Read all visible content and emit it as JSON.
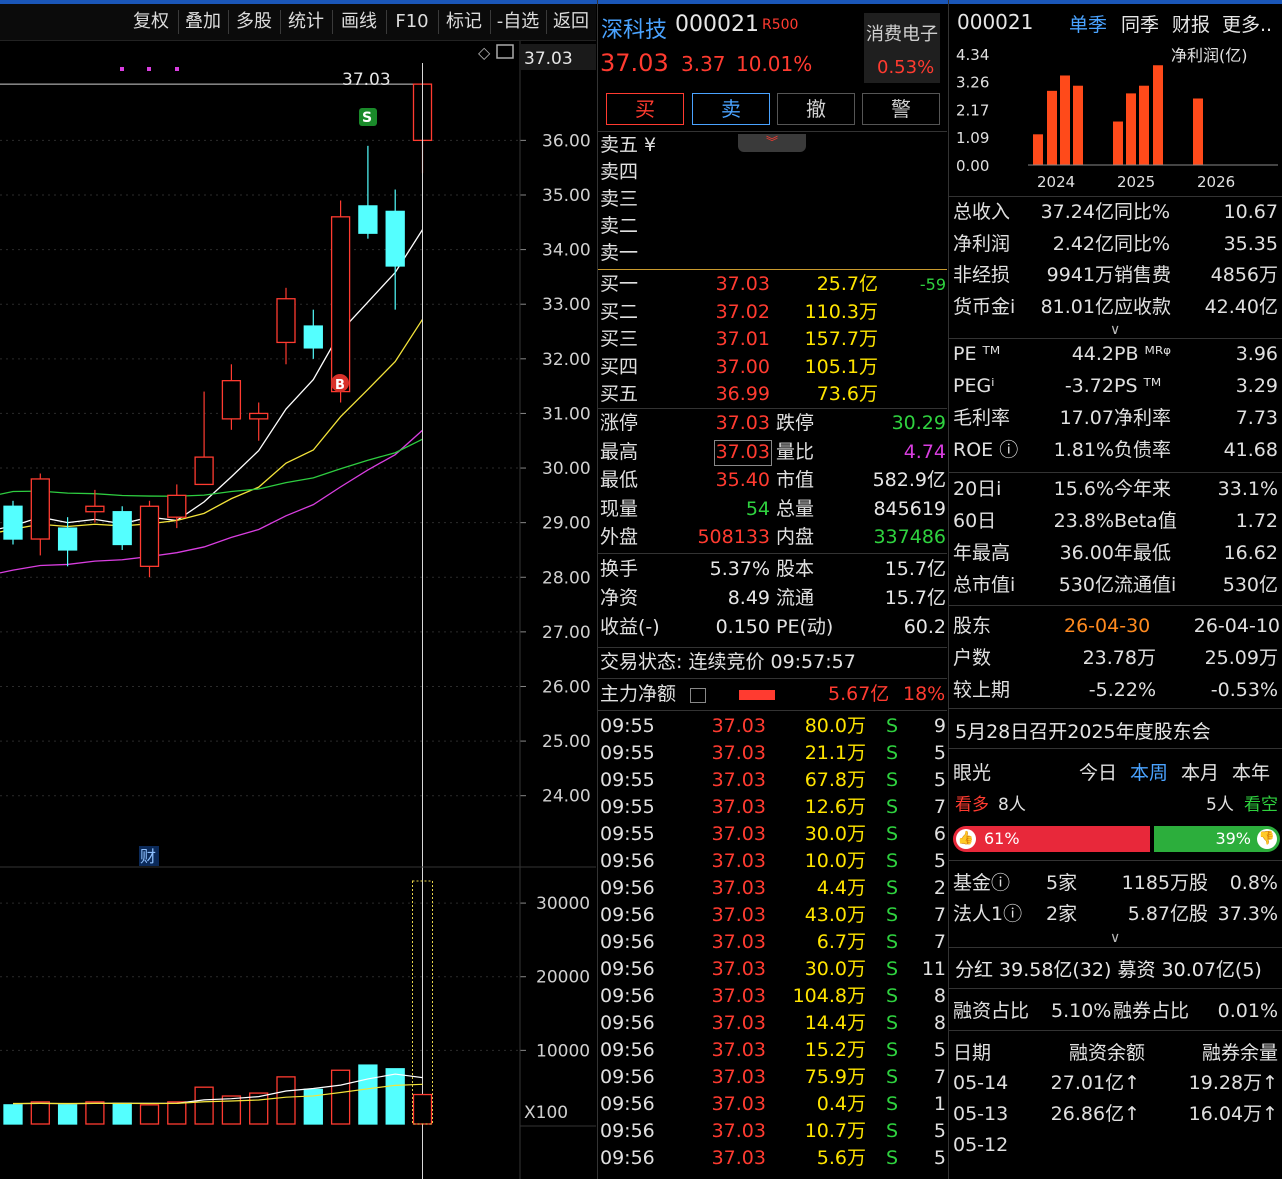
{
  "toolbar": {
    "items": [
      "复权",
      "叠加",
      "多股",
      "统计",
      "画线",
      "F10",
      "标记",
      "-自选",
      "返回"
    ]
  },
  "chart": {
    "price_axis": [
      "36.00",
      "35.00",
      "34.00",
      "33.00",
      "32.00",
      "31.00",
      "30.00",
      "29.00",
      "28.00",
      "27.00",
      "26.00",
      "25.00",
      "24.00"
    ],
    "price_tag": "37.03",
    "high_label": "37.03",
    "volume_axis": [
      "30000",
      "20000",
      "10000"
    ],
    "volume_unit": "X100",
    "signal_s": "S",
    "signal_b": "B",
    "fin_marker": "财"
  },
  "chart_data": {
    "type": "candlestick",
    "candles": [
      {
        "o": 29.3,
        "c": 28.7,
        "h": 29.4,
        "l": 28.6
      },
      {
        "o": 28.7,
        "c": 29.8,
        "h": 29.9,
        "l": 28.4
      },
      {
        "o": 28.9,
        "c": 28.5,
        "h": 29.1,
        "l": 28.2
      },
      {
        "o": 29.2,
        "c": 29.3,
        "h": 29.6,
        "l": 29.0
      },
      {
        "o": 29.2,
        "c": 28.6,
        "h": 29.3,
        "l": 28.5
      },
      {
        "o": 28.2,
        "c": 29.3,
        "h": 29.4,
        "l": 28.0
      },
      {
        "o": 29.1,
        "c": 29.5,
        "h": 29.7,
        "l": 28.9
      },
      {
        "o": 29.7,
        "c": 30.2,
        "h": 31.4,
        "l": 29.7
      },
      {
        "o": 30.9,
        "c": 31.6,
        "h": 31.9,
        "l": 30.7
      },
      {
        "o": 30.9,
        "c": 31.0,
        "h": 31.2,
        "l": 30.5
      },
      {
        "o": 32.3,
        "c": 33.1,
        "h": 33.3,
        "l": 31.9
      },
      {
        "o": 32.6,
        "c": 32.2,
        "h": 32.9,
        "l": 32.0
      },
      {
        "o": 31.4,
        "c": 34.6,
        "h": 34.9,
        "l": 31.2
      },
      {
        "o": 34.8,
        "c": 34.3,
        "h": 35.9,
        "l": 34.2
      },
      {
        "o": 34.7,
        "c": 33.7,
        "h": 35.1,
        "l": 32.9
      },
      {
        "o": 36.0,
        "c": 37.03,
        "h": 37.03,
        "l": 35.4
      }
    ],
    "volume": [
      2600,
      3000,
      2600,
      3000,
      2800,
      2600,
      3000,
      5000,
      3800,
      4200,
      6400,
      4700,
      7300,
      8000,
      7500,
      4000
    ],
    "ylim": [
      23.5,
      37.6
    ],
    "volume_ylim": [
      0,
      33000
    ]
  },
  "quote": {
    "name": "深科技",
    "code": "000021",
    "badge": "R500",
    "price": "37.03",
    "change": "3.37",
    "change_pct": "10.01%",
    "sector": "消费电子",
    "sector_pct": "0.53%",
    "buttons": {
      "buy": "买",
      "sell": "卖",
      "cancel": "撤",
      "alert": "警"
    },
    "asks": [
      {
        "label": "卖五 ¥",
        "price": "",
        "vol": ""
      },
      {
        "label": "卖四",
        "price": "",
        "vol": ""
      },
      {
        "label": "卖三",
        "price": "",
        "vol": ""
      },
      {
        "label": "卖二",
        "price": "",
        "vol": ""
      },
      {
        "label": "卖一",
        "price": "",
        "vol": ""
      }
    ],
    "bids": [
      {
        "label": "买一",
        "price": "37.03",
        "vol": "25.7亿",
        "chg": "-59"
      },
      {
        "label": "买二",
        "price": "37.02",
        "vol": "110.3万",
        "chg": ""
      },
      {
        "label": "买三",
        "price": "37.01",
        "vol": "157.7万",
        "chg": ""
      },
      {
        "label": "买四",
        "price": "37.00",
        "vol": "105.1万",
        "chg": ""
      },
      {
        "label": "买五",
        "price": "36.99",
        "vol": "73.6万",
        "chg": ""
      }
    ],
    "stats": [
      {
        "l1": "涨停",
        "v1": "37.03",
        "l2": "跌停",
        "v2": "30.29"
      },
      {
        "l1": "最高",
        "v1": "37.03",
        "l2": "量比",
        "v2": "4.74"
      },
      {
        "l1": "最低",
        "v1": "35.40",
        "l2": "市值",
        "v2": "582.9亿"
      },
      {
        "l1": "现量",
        "v1": "54",
        "l2": "总量",
        "v2": "845619"
      },
      {
        "l1": "外盘",
        "v1": "508133",
        "l2": "内盘",
        "v2": "337486"
      }
    ],
    "stats2": [
      {
        "l1": "换手",
        "v1": "5.37%",
        "l2": "股本",
        "v2": "15.7亿"
      },
      {
        "l1": "净资",
        "v1": "8.49",
        "l2": "流通",
        "v2": "15.7亿"
      },
      {
        "l1": "收益(-)",
        "v1": "0.150",
        "l2": "PE(动)",
        "v2": "60.2"
      }
    ],
    "trade_status": "交易状态: 连续竞价 09:57:57",
    "main_flow_label": "主力净额",
    "main_flow_value": "5.67亿",
    "main_flow_pct": "18%",
    "ticks": [
      {
        "t": "09:55",
        "p": "37.03",
        "v": "80.0万",
        "s": "S",
        "n": "9"
      },
      {
        "t": "09:55",
        "p": "37.03",
        "v": "21.1万",
        "s": "S",
        "n": "5"
      },
      {
        "t": "09:55",
        "p": "37.03",
        "v": "67.8万",
        "s": "S",
        "n": "5"
      },
      {
        "t": "09:55",
        "p": "37.03",
        "v": "12.6万",
        "s": "S",
        "n": "7"
      },
      {
        "t": "09:55",
        "p": "37.03",
        "v": "30.0万",
        "s": "S",
        "n": "6"
      },
      {
        "t": "09:56",
        "p": "37.03",
        "v": "10.0万",
        "s": "S",
        "n": "5"
      },
      {
        "t": "09:56",
        "p": "37.03",
        "v": "4.4万",
        "s": "S",
        "n": "2"
      },
      {
        "t": "09:56",
        "p": "37.03",
        "v": "43.0万",
        "s": "S",
        "n": "7"
      },
      {
        "t": "09:56",
        "p": "37.03",
        "v": "6.7万",
        "s": "S",
        "n": "7"
      },
      {
        "t": "09:56",
        "p": "37.03",
        "v": "30.0万",
        "s": "S",
        "n": "11"
      },
      {
        "t": "09:56",
        "p": "37.03",
        "v": "104.8万",
        "s": "S",
        "n": "8"
      },
      {
        "t": "09:56",
        "p": "37.03",
        "v": "14.4万",
        "s": "S",
        "n": "8"
      },
      {
        "t": "09:56",
        "p": "37.03",
        "v": "15.2万",
        "s": "S",
        "n": "5"
      },
      {
        "t": "09:56",
        "p": "37.03",
        "v": "75.9万",
        "s": "S",
        "n": "7"
      },
      {
        "t": "09:56",
        "p": "37.03",
        "v": "0.4万",
        "s": "S",
        "n": "1"
      },
      {
        "t": "09:56",
        "p": "37.03",
        "v": "10.7万",
        "s": "S",
        "n": "5"
      },
      {
        "t": "09:56",
        "p": "37.03",
        "v": "5.6万",
        "s": "S",
        "n": "5"
      }
    ]
  },
  "fin": {
    "code": "000021",
    "tabs": [
      "单季",
      "同季",
      "财报",
      "更多.."
    ],
    "mini_chart_title": "净利润(亿)",
    "mini_y": [
      "4.34",
      "3.26",
      "2.17",
      "1.09",
      "0.00"
    ],
    "mini_x": [
      "2024",
      "2025",
      "2026"
    ],
    "bars": [
      1.2,
      2.9,
      3.5,
      3.1,
      1.7,
      2.8,
      3.1,
      3.9,
      2.6
    ],
    "rows1": [
      {
        "a": "总收入",
        "b": "37.24亿",
        "c": "同比%",
        "d": "10.67"
      },
      {
        "a": "净利润",
        "b": "2.42亿",
        "c": "同比%",
        "d": "35.35"
      },
      {
        "a": "非经损",
        "b": "9941万",
        "c": "销售费",
        "d": "4856万"
      },
      {
        "a": "货币金i",
        "b": "81.01亿",
        "c": "应收款",
        "d": "42.40亿"
      }
    ],
    "rows2": [
      {
        "a": "PE ᵀᴹ",
        "b": "44.2",
        "c": "PB ᴹᴿᵠ",
        "d": "3.96"
      },
      {
        "a": "PEGⁱ",
        "b": "-3.72",
        "c": "PS ᵀᴹ",
        "d": "3.29"
      },
      {
        "a": "毛利率",
        "b": "17.07",
        "c": "净利率",
        "d": "7.73"
      },
      {
        "a": "ROE ⓘ",
        "b": "1.81%",
        "c": "负债率",
        "d": "41.68"
      }
    ],
    "rows3": [
      {
        "a": "20日i",
        "b": "15.6%",
        "c": "今年来",
        "d": "33.1%"
      },
      {
        "a": "60日",
        "b": "23.8%",
        "c": "Beta值",
        "d": "1.72"
      },
      {
        "a": "年最高",
        "b": "36.00",
        "c": "年最低",
        "d": "16.62"
      },
      {
        "a": "总市值i",
        "b": "530亿",
        "c": "流通值i",
        "d": "530亿"
      }
    ],
    "holders": {
      "label": "股东",
      "d1": "26-04-30",
      "d2": "26-04-10"
    },
    "holders_rows": [
      {
        "a": "户数",
        "b": "23.78万",
        "c": "25.09万"
      },
      {
        "a": "较上期",
        "b": "-5.22%",
        "c": "-0.53%"
      }
    ],
    "notice": "5月28日召开2025年度股东会",
    "vision": {
      "label": "眼光",
      "tabs": [
        "今日",
        "本周",
        "本月",
        "本年"
      ]
    },
    "bull_label": "看多",
    "bull_count": "8人",
    "bear_count": "5人",
    "bear_label": "看空",
    "bull_pct": "61%",
    "bear_pct": "39%",
    "bull_ratio": 0.61,
    "inst": [
      {
        "a": "基金ⓘ",
        "b": "5家",
        "c": "1185万股",
        "d": "0.8%"
      },
      {
        "a": "法人1ⓘ",
        "b": "2家",
        "c": "5.87亿股",
        "d": "37.3%"
      }
    ],
    "dividend": "分红 39.58亿(32) 募资 30.07亿(5)",
    "margin": {
      "a": "融资占比",
      "b": "5.10%",
      "c": "融券占比",
      "d": "0.01%"
    },
    "margin_head": [
      "日期",
      "融资余额",
      "融券余量"
    ],
    "margin_rows": [
      {
        "d": "05-14",
        "a": "27.01亿↑",
        "b": "19.28万↑"
      },
      {
        "d": "05-13",
        "a": "26.86亿↑",
        "b": "16.04万↑"
      },
      {
        "d": "05-12",
        "a": "",
        "b": ""
      }
    ]
  }
}
